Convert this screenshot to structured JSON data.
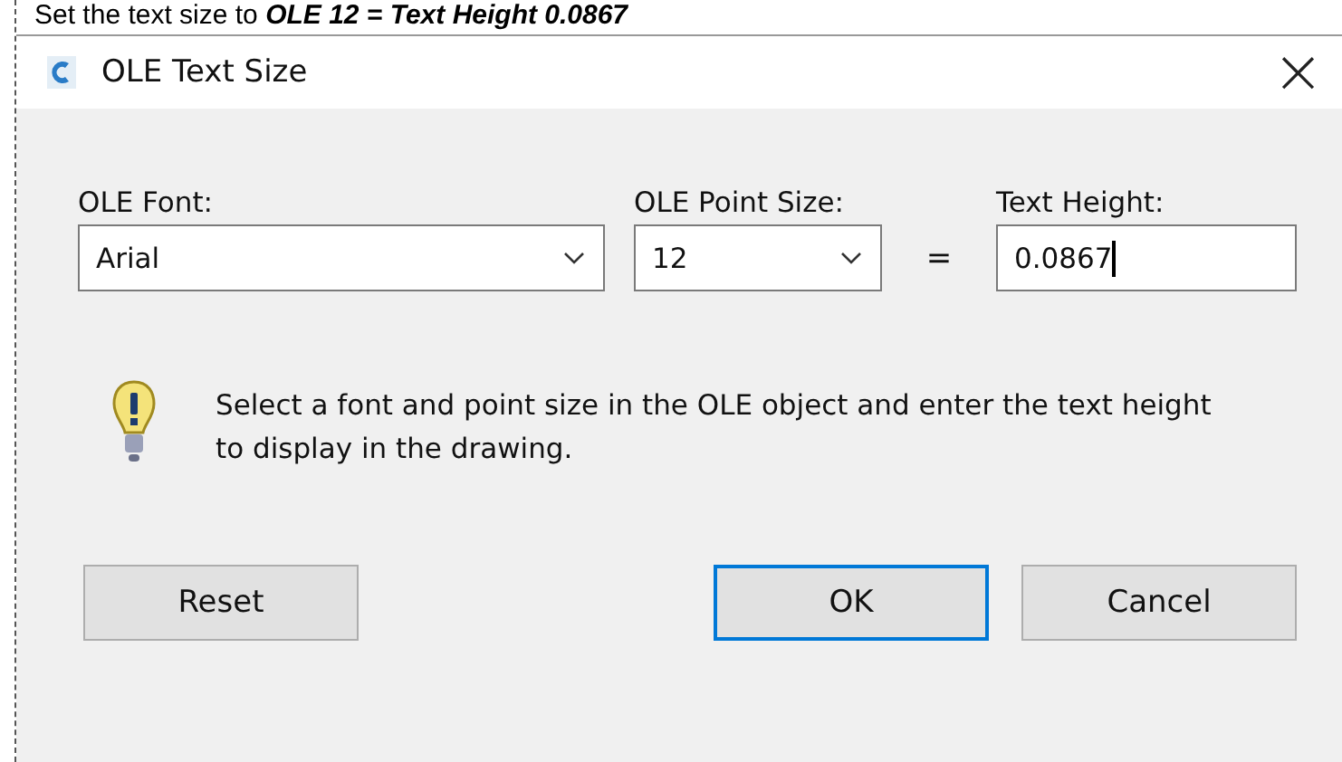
{
  "caption": "Set the text size to **OLE 12 = Text Height 0.0867**",
  "window": {
    "title": "OLE Text Size",
    "close": "×"
  },
  "fields": [
    {
      "kind": "combo",
      "label": "OLE Font:",
      "value": "Arial"
    },
    {
      "kind": "combo",
      "label": "OLE Point Size:",
      "value": "12"
    },
    {
      "kind": "equals",
      "label": "="
    },
    {
      "kind": "text",
      "label": "Text Height:",
      "value": "0.0867",
      "focused": true
    }
  ],
  "message": "Select a font and point size in the OLE object and enter the text height to display in the drawing.",
  "buttons": [
    {
      "label": "Reset",
      "default": false
    },
    {
      "label": "OK",
      "default": true
    },
    {
      "label": "Cancel",
      "default": false
    }
  ]
}
